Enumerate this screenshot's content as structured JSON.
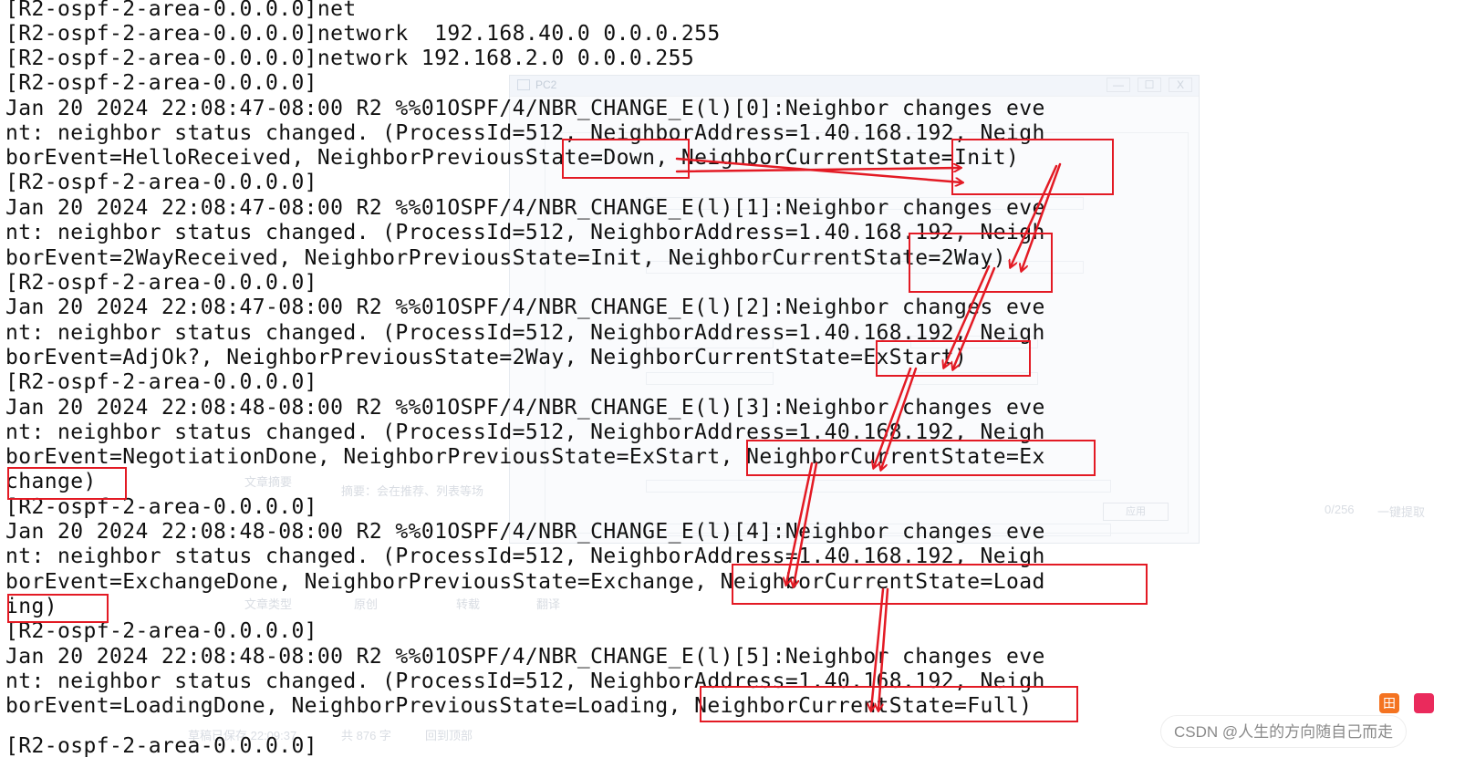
{
  "pc_window": {
    "title": "PC2",
    "minimize_glyph": "—",
    "maximize_glyph": "☐",
    "close_glyph": "X",
    "apply_label": "应用"
  },
  "editor_ghost": {
    "summary_label": "文章摘要",
    "summary_placeholder": "摘要：会在推荐、列表等场",
    "char_count": "0/256",
    "extract_button": "一键提取",
    "type_label": "文章类型",
    "type_original": "原创",
    "type_repost": "转载",
    "type_translate": "翻译",
    "saved_status": "草稿已保存 22:09:37",
    "word_count": "共 876 字",
    "back_to_top": "回到顶部"
  },
  "terminal": {
    "lines": [
      "[R2-ospf-2-area-0.0.0.0]net",
      "[R2-ospf-2-area-0.0.0.0]network  192.168.40.0 0.0.0.255",
      "[R2-ospf-2-area-0.0.0.0]network 192.168.2.0 0.0.0.255",
      "[R2-ospf-2-area-0.0.0.0]",
      "Jan 20 2024 22:08:47-08:00 R2 %%01OSPF/4/NBR_CHANGE_E(l)[0]:Neighbor changes eve",
      "nt: neighbor status changed. (ProcessId=512, NeighborAddress=1.40.168.192, Neigh",
      "borEvent=HelloReceived, NeighborPreviousState=Down, NeighborCurrentState=Init)",
      "[R2-ospf-2-area-0.0.0.0]",
      "Jan 20 2024 22:08:47-08:00 R2 %%01OSPF/4/NBR_CHANGE_E(l)[1]:Neighbor changes eve",
      "nt: neighbor status changed. (ProcessId=512, NeighborAddress=1.40.168.192, Neigh",
      "borEvent=2WayReceived, NeighborPreviousState=Init, NeighborCurrentState=2Way)",
      "[R2-ospf-2-area-0.0.0.0]",
      "Jan 20 2024 22:08:47-08:00 R2 %%01OSPF/4/NBR_CHANGE_E(l)[2]:Neighbor changes eve",
      "nt: neighbor status changed. (ProcessId=512, NeighborAddress=1.40.168.192, Neigh",
      "borEvent=AdjOk?, NeighborPreviousState=2Way, NeighborCurrentState=ExStart)",
      "[R2-ospf-2-area-0.0.0.0]",
      "Jan 20 2024 22:08:48-08:00 R2 %%01OSPF/4/NBR_CHANGE_E(l)[3]:Neighbor changes eve",
      "nt: neighbor status changed. (ProcessId=512, NeighborAddress=1.40.168.192, Neigh",
      "borEvent=NegotiationDone, NeighborPreviousState=ExStart, NeighborCurrentState=Ex",
      "change)",
      "[R2-ospf-2-area-0.0.0.0]",
      "Jan 20 2024 22:08:48-08:00 R2 %%01OSPF/4/NBR_CHANGE_E(l)[4]:Neighbor changes eve",
      "nt: neighbor status changed. (ProcessId=512, NeighborAddress=1.40.168.192, Neigh",
      "borEvent=ExchangeDone, NeighborPreviousState=Exchange, NeighborCurrentState=Load",
      "ing)",
      "[R2-ospf-2-area-0.0.0.0]",
      "Jan 20 2024 22:08:48-08:00 R2 %%01OSPF/4/NBR_CHANGE_E(l)[5]:Neighbor changes eve",
      "nt: neighbor status changed. (ProcessId=512, NeighborAddress=1.40.168.192, Neigh",
      "borEvent=LoadingDone, NeighborPreviousState=Loading, NeighborCurrentState=Full)",
      "[R2-ospf-2-area-0.0.0.0]"
    ]
  },
  "annotation_color": "#e31a24",
  "watermark": {
    "text": "CSDN @人生的方向随自己而走"
  },
  "side_icons": {
    "a_glyph": "田"
  }
}
